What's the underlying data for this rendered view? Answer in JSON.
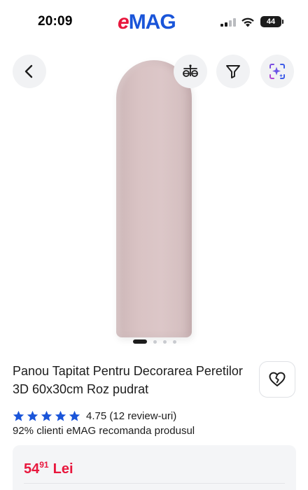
{
  "status_bar": {
    "time": "20:09",
    "brand_e": "e",
    "brand_rest": "MAG",
    "battery": "44"
  },
  "colors": {
    "brand_red": "#e8173d",
    "brand_blue": "#1a55d9",
    "star_blue": "#1a55d9",
    "price_red": "#e8173d"
  },
  "toolbar": {
    "back_icon": "chevron-left-icon",
    "compare_icon": "scale-compare-icon",
    "filter_icon": "funnel-icon",
    "ai_icon": "sparkle-scan-icon"
  },
  "gallery": {
    "image_count": 4,
    "active_index": 0
  },
  "product": {
    "title": "Panou Tapitat Pentru Decorarea Peretilor 3D 60x30cm Roz pudrat",
    "rating_stars": 4.75,
    "rating_text": "4.75 (12 review-uri)",
    "recommend_text": "92% clienti eMAG recomanda produsul"
  },
  "price": {
    "integer": "54",
    "decimals": "91",
    "currency": "Lei"
  }
}
